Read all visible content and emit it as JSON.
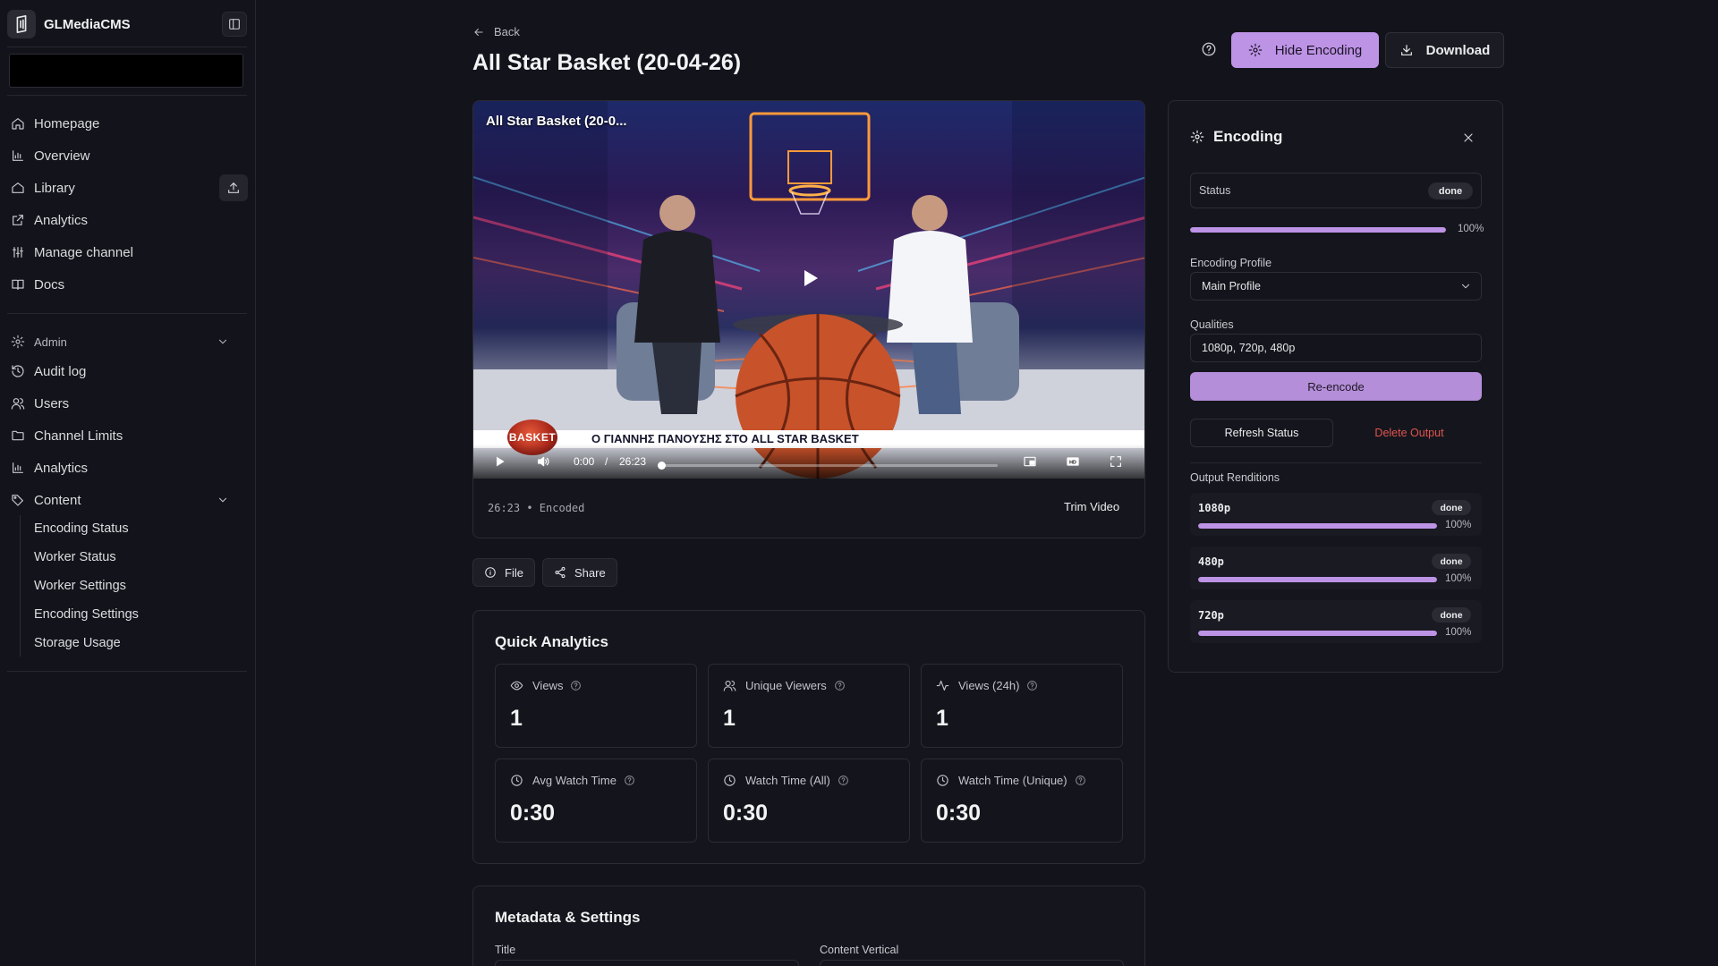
{
  "brand": {
    "name": "GLMediaCMS"
  },
  "nav": [
    {
      "label": "Homepage",
      "icon": "home-icon"
    },
    {
      "label": "Overview",
      "icon": "bar-chart-icon"
    },
    {
      "label": "Library",
      "icon": "library-icon"
    },
    {
      "label": "Analytics",
      "icon": "external-link-icon"
    },
    {
      "label": "Manage channel",
      "icon": "sliders-icon"
    },
    {
      "label": "Docs",
      "icon": "book-icon"
    }
  ],
  "admin": {
    "label": "Admin",
    "items": [
      {
        "label": "Audit log",
        "icon": "history-icon"
      },
      {
        "label": "Users",
        "icon": "users-icon"
      },
      {
        "label": "Channel Limits",
        "icon": "folder-icon"
      },
      {
        "label": "Analytics",
        "icon": "bar-chart-icon"
      }
    ],
    "content": {
      "label": "Content",
      "items": [
        "Encoding Status",
        "Worker Status",
        "Worker Settings",
        "Encoding Settings",
        "Storage Usage"
      ]
    }
  },
  "header": {
    "back": "Back",
    "title": "All Star Basket (20-04-26)",
    "hide_encoding": "Hide Encoding",
    "download": "Download"
  },
  "video": {
    "overlay_title": "All Star Basket (20-0...",
    "ticker": "Ο ΓΙΑΝΝΗΣ ΠΑΝΟΥΣΗΣ ΣΤΟ ALL STAR BASKET",
    "ticker_logo": "BASKET",
    "current_time": "0:00",
    "separator": "/",
    "duration": "26:23",
    "progress_fraction": 0.0,
    "meta": "26:23 • Encoded",
    "trim": "Trim Video"
  },
  "actions": {
    "file": "File",
    "share": "Share"
  },
  "quick_analytics": {
    "title": "Quick Analytics",
    "stats": [
      {
        "label": "Views",
        "value": "1",
        "icon": "eye-icon"
      },
      {
        "label": "Unique Viewers",
        "value": "1",
        "icon": "users-icon"
      },
      {
        "label": "Views (24h)",
        "value": "1",
        "icon": "activity-icon"
      },
      {
        "label": "Avg Watch Time",
        "value": "0:30",
        "icon": "clock-icon"
      },
      {
        "label": "Watch Time (All)",
        "value": "0:30",
        "icon": "clock-icon"
      },
      {
        "label": "Watch Time (Unique)",
        "value": "0:30",
        "icon": "clock-icon"
      }
    ]
  },
  "metadata": {
    "title": "Metadata & Settings",
    "fields": [
      "Title",
      "Content Vertical"
    ]
  },
  "encoding": {
    "title": "Encoding",
    "status_label": "Status",
    "status": "done",
    "progress_percent": 100,
    "progress_label": "100%",
    "profile_label": "Encoding Profile",
    "profile": "Main Profile",
    "qualities_label": "Qualities",
    "qualities": "1080p, 720p, 480p",
    "reencode": "Re-encode",
    "refresh": "Refresh Status",
    "delete": "Delete Output",
    "renditions_label": "Output Renditions",
    "renditions": [
      {
        "name": "1080p",
        "status": "done",
        "percent": 100,
        "label": "100%"
      },
      {
        "name": "480p",
        "status": "done",
        "percent": 100,
        "label": "100%"
      },
      {
        "name": "720p",
        "status": "done",
        "percent": 100,
        "label": "100%"
      }
    ]
  },
  "colors": {
    "accent": "#bd93e6",
    "danger": "#e0534e",
    "background": "#13141b"
  }
}
